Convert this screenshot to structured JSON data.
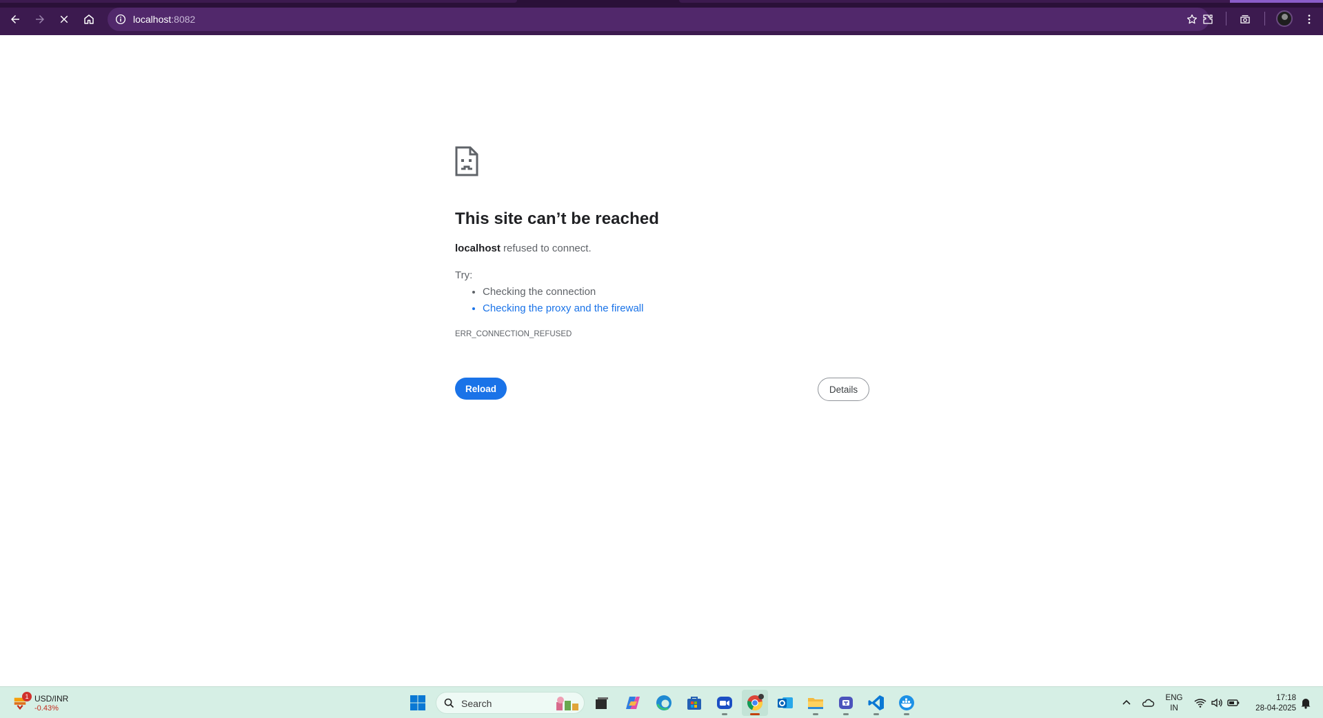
{
  "browser": {
    "url_host": "localhost",
    "url_port": ":8082",
    "icons": [
      "back-icon",
      "forward-icon",
      "stop-icon",
      "home-icon",
      "site-info-icon",
      "bookmark-star-icon",
      "extensions-icon",
      "media-icon",
      "profile-avatar",
      "menu-icon"
    ]
  },
  "error_page": {
    "title": "This site can’t be reached",
    "host": "localhost",
    "message_rest": " refused to connect.",
    "try_label": "Try:",
    "suggestions": [
      "Checking the connection",
      "Checking the proxy and the firewall"
    ],
    "error_code": "ERR_CONNECTION_REFUSED",
    "reload_label": "Reload",
    "details_label": "Details"
  },
  "taskbar": {
    "widget": {
      "badge": "1",
      "ticker": "USD/INR",
      "change": "-0.43%"
    },
    "search_placeholder": "Search",
    "apps": [
      "start",
      "task-view",
      "copilot",
      "edge",
      "store",
      "zoom",
      "chrome",
      "outlook",
      "file-explorer",
      "teams",
      "vscode",
      "docker"
    ],
    "tray": {
      "lang_line1": "ENG",
      "lang_line2": "IN",
      "time": "17:18",
      "date": "28-04-2025"
    },
    "accent_colors": {
      "toolbar": "#3c1a4f",
      "taskbar": "#d6efe5",
      "link": "#1a73e8"
    }
  }
}
